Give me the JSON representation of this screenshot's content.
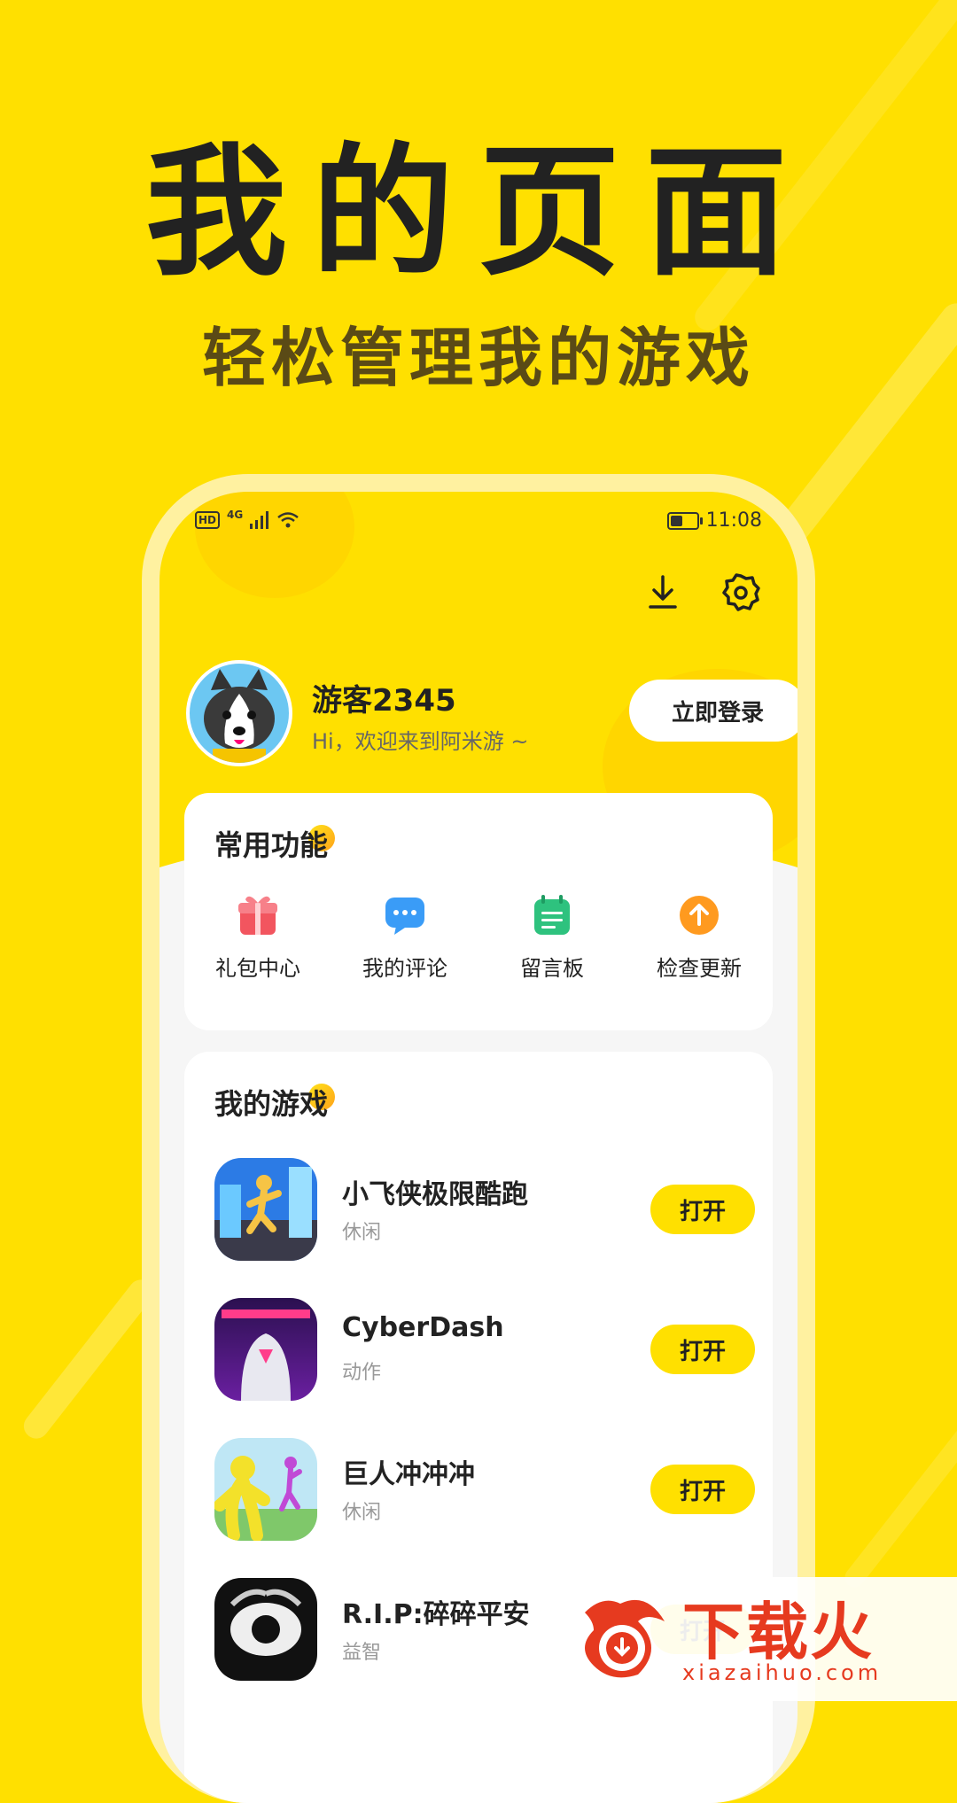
{
  "promo": {
    "title": "我的页面",
    "subtitle": "轻松管理我的游戏"
  },
  "status_bar": {
    "hd": "HD",
    "network": "4G",
    "time": "11:08",
    "battery_level": 0.45
  },
  "top_actions": {
    "download_icon": "download-icon",
    "settings_icon": "gear-icon"
  },
  "profile": {
    "username": "游客2345",
    "greeting": "Hi，欢迎来到阿米游 ~",
    "login_label": "立即登录"
  },
  "common_functions": {
    "title": "常用功能",
    "items": [
      {
        "label": "礼包中心",
        "icon": "gift-icon",
        "color": "#F2555F"
      },
      {
        "label": "我的评论",
        "icon": "comment-icon",
        "color": "#3A9CF7"
      },
      {
        "label": "留言板",
        "icon": "notepad-icon",
        "color": "#2EC27E"
      },
      {
        "label": "检查更新",
        "icon": "update-arrow-icon",
        "color": "#FF9A1F"
      }
    ]
  },
  "my_games": {
    "title": "我的游戏",
    "open_label": "打开",
    "items": [
      {
        "name": "小飞侠极限酷跑",
        "category": "休闲"
      },
      {
        "name": "CyberDash",
        "category": "动作"
      },
      {
        "name": "巨人冲冲冲",
        "category": "休闲"
      },
      {
        "name": "R.I.P:碎碎平安",
        "category": "益智"
      }
    ]
  },
  "watermark": {
    "brand": "下载火",
    "url": "xiazaihuo.com"
  },
  "colors": {
    "accent": "#FFE000",
    "text": "#222222",
    "watermark": "#E63A1F"
  }
}
